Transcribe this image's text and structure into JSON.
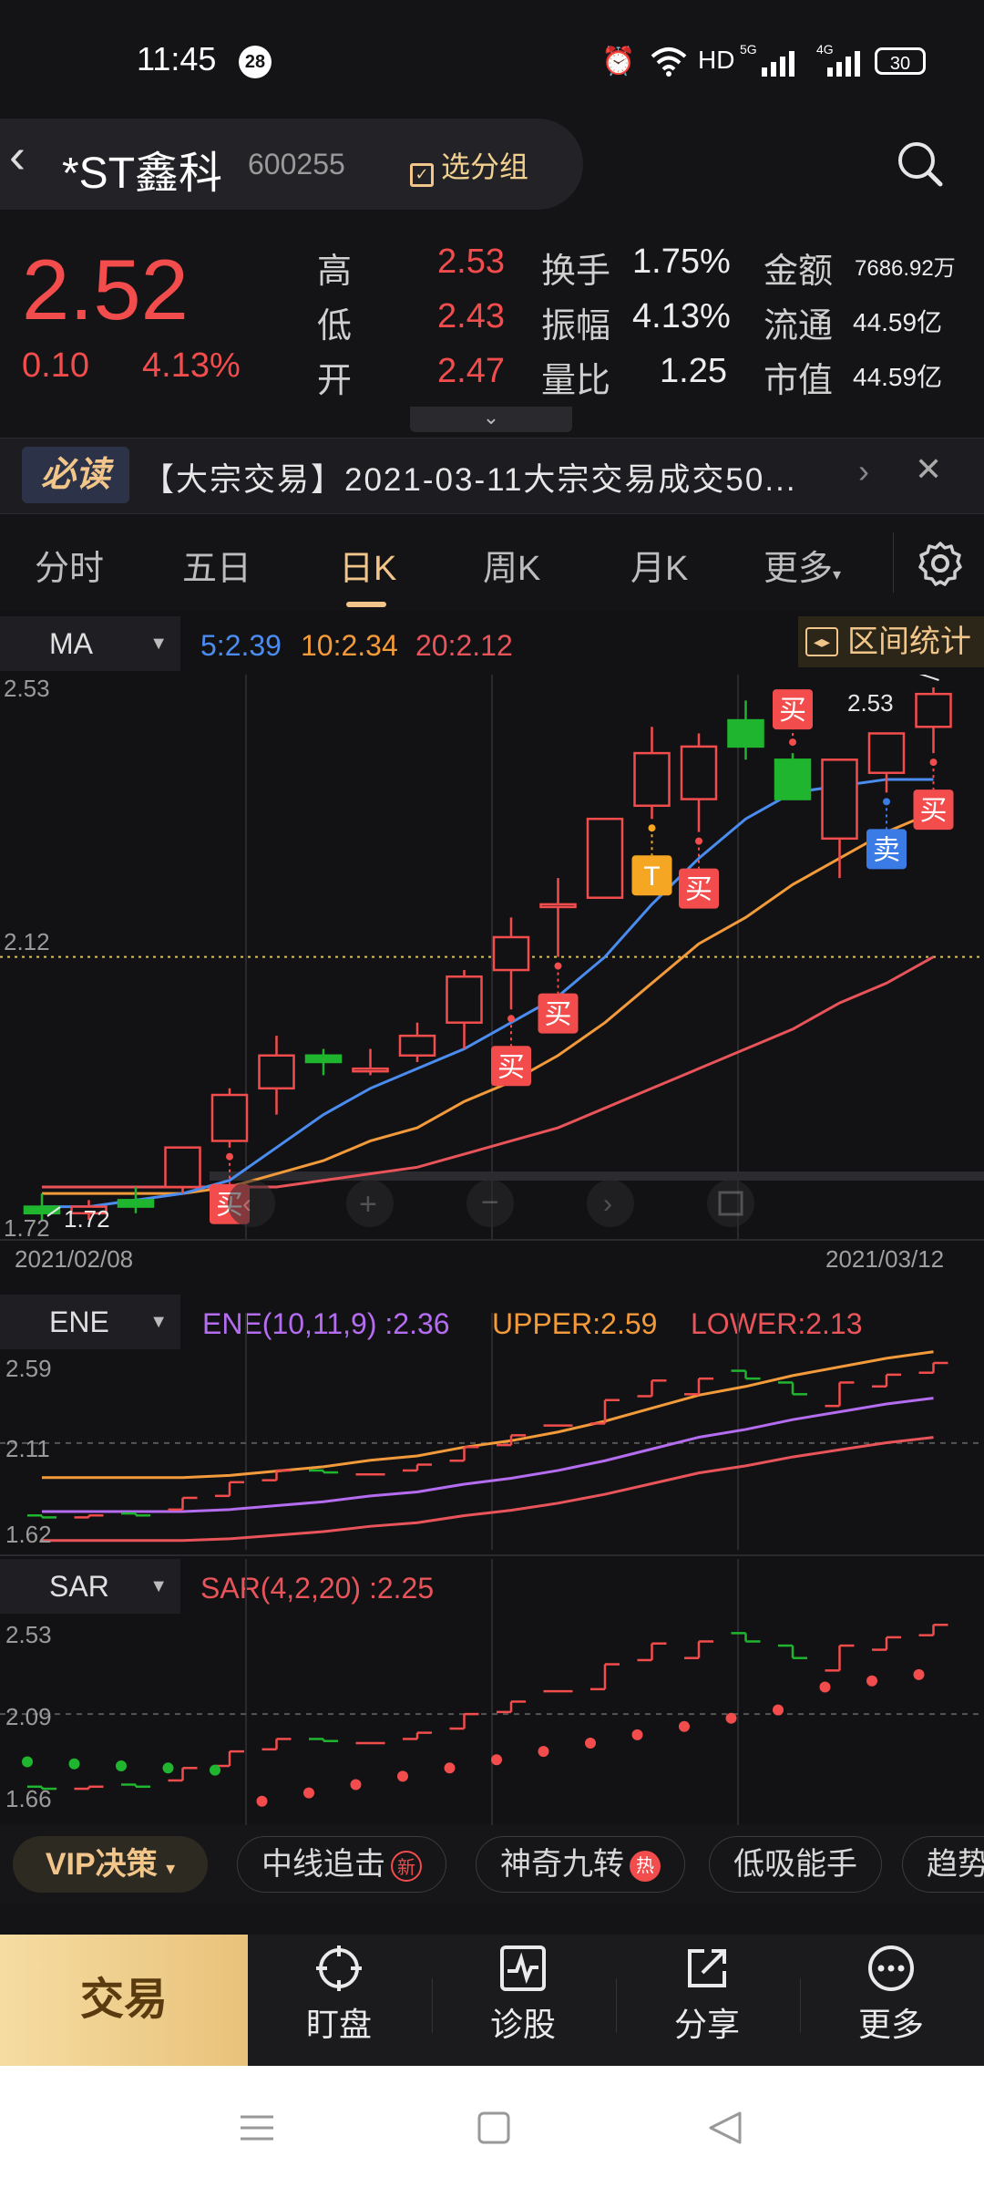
{
  "status": {
    "time": "11:45",
    "notif_count": "28",
    "hd": "HD",
    "net1": "5G",
    "net2": "4G",
    "battery": "30"
  },
  "header": {
    "name": "*ST鑫科",
    "code": "600255",
    "group_label": "选分组"
  },
  "quote": {
    "price": "2.52",
    "change": "0.10",
    "change_pct": "4.13%",
    "high_label": "高",
    "high": "2.53",
    "low_label": "低",
    "low": "2.43",
    "open_label": "开",
    "open": "2.47",
    "turnover_label": "换手",
    "turnover": "1.75%",
    "amplitude_label": "振幅",
    "amplitude": "4.13%",
    "volratio_label": "量比",
    "volratio": "1.25",
    "amount_label": "金额",
    "amount": "7686.92万",
    "float_label": "流通",
    "float": "44.59亿",
    "mcap_label": "市值",
    "mcap": "44.59亿"
  },
  "news": {
    "tag": "必读",
    "text": "【大宗交易】2021-03-11大宗交易成交50..."
  },
  "tabs": [
    "分时",
    "五日",
    "日K",
    "周K",
    "月K",
    "更多"
  ],
  "main_chart": {
    "indicator": "MA",
    "ma5": "5:2.39",
    "ma10": "10:2.34",
    "ma20": "20:2.12",
    "range_label": "区间统计",
    "top_label": "2.53",
    "mid_label": "2.12",
    "bottom_label": "1.72",
    "high_callout": "2.53",
    "low_callout": "1.72",
    "start_date": "2021/02/08",
    "end_date": "2021/03/12",
    "buy_label": "买",
    "sell_label": "卖",
    "t_label": "T"
  },
  "ene_panel": {
    "indicator": "ENE",
    "ene": "ENE(10,11,9) :2.36",
    "upper": "UPPER:2.59",
    "lower": "LOWER:2.13",
    "top_label": "2.59",
    "mid_label": "2.11",
    "bottom_label": "1.62"
  },
  "sar_panel": {
    "indicator": "SAR",
    "sar": "SAR(4,2,20) :2.25",
    "top_label": "2.53",
    "mid_label": "2.09",
    "bottom_label": "1.66"
  },
  "vip_strip": {
    "vip": "VIP决策",
    "items": [
      {
        "label": "中线追击",
        "badge": "新"
      },
      {
        "label": "神奇九转",
        "badge": "热"
      },
      {
        "label": "低吸能手",
        "badge": ""
      },
      {
        "label": "趋势",
        "badge": ""
      }
    ]
  },
  "bottom_nav": {
    "trade": "交易",
    "items": [
      "盯盘",
      "诊股",
      "分享",
      "更多"
    ]
  },
  "colors": {
    "up": "#f24c4c",
    "down": "#1fb52f",
    "ma5": "#4a8cf0",
    "ma10": "#f39a3a",
    "ma20": "#e8545a",
    "ene": "#b46cf0",
    "accent": "#f2c58a"
  },
  "chart_data": {
    "type": "candlestick",
    "period": "daily",
    "dates": [
      "2021/02/08",
      "2021/03/12"
    ],
    "candles": [
      {
        "o": 1.74,
        "c": 1.73,
        "h": 1.76,
        "l": 1.72
      },
      {
        "o": 1.73,
        "c": 1.74,
        "h": 1.75,
        "l": 1.72
      },
      {
        "o": 1.75,
        "c": 1.74,
        "h": 1.77,
        "l": 1.73
      },
      {
        "o": 1.77,
        "c": 1.83,
        "h": 1.83,
        "l": 1.76
      },
      {
        "o": 1.84,
        "c": 1.91,
        "h": 1.92,
        "l": 1.83
      },
      {
        "o": 1.92,
        "c": 1.97,
        "h": 2.0,
        "l": 1.88
      },
      {
        "o": 1.97,
        "c": 1.96,
        "h": 1.98,
        "l": 1.94
      },
      {
        "o": 1.95,
        "c": 1.95,
        "h": 1.98,
        "l": 1.94
      },
      {
        "o": 1.97,
        "c": 2.0,
        "h": 2.02,
        "l": 1.96
      },
      {
        "o": 2.02,
        "c": 2.09,
        "h": 2.1,
        "l": 1.98
      },
      {
        "o": 2.1,
        "c": 2.15,
        "h": 2.18,
        "l": 2.04
      },
      {
        "o": 2.2,
        "c": 2.2,
        "h": 2.24,
        "l": 2.12
      },
      {
        "o": 2.21,
        "c": 2.33,
        "h": 2.33,
        "l": 2.21
      },
      {
        "o": 2.35,
        "c": 2.43,
        "h": 2.47,
        "l": 2.33
      },
      {
        "o": 2.36,
        "c": 2.44,
        "h": 2.46,
        "l": 2.31
      },
      {
        "o": 2.48,
        "c": 2.44,
        "h": 2.51,
        "l": 2.42
      },
      {
        "o": 2.42,
        "c": 2.36,
        "h": 2.43,
        "l": 2.36
      },
      {
        "o": 2.3,
        "c": 2.42,
        "h": 2.42,
        "l": 2.24
      },
      {
        "o": 2.4,
        "c": 2.46,
        "h": 2.46,
        "l": 2.37
      },
      {
        "o": 2.47,
        "c": 2.52,
        "h": 2.53,
        "l": 2.43
      }
    ],
    "ma5": [
      1.74,
      1.74,
      1.75,
      1.76,
      1.78,
      1.83,
      1.88,
      1.92,
      1.95,
      1.98,
      2.02,
      2.06,
      2.12,
      2.2,
      2.27,
      2.33,
      2.37,
      2.38,
      2.39,
      2.39
    ],
    "ma10": [
      1.76,
      1.76,
      1.76,
      1.76,
      1.77,
      1.79,
      1.81,
      1.84,
      1.86,
      1.9,
      1.93,
      1.97,
      2.02,
      2.08,
      2.14,
      2.18,
      2.23,
      2.27,
      2.31,
      2.34
    ],
    "ma20": [
      1.77,
      1.77,
      1.77,
      1.77,
      1.77,
      1.77,
      1.78,
      1.79,
      1.8,
      1.82,
      1.84,
      1.86,
      1.89,
      1.92,
      1.95,
      1.98,
      2.01,
      2.05,
      2.08,
      2.12
    ],
    "signals": [
      {
        "i": 4,
        "type": "买"
      },
      {
        "i": 10,
        "type": "买"
      },
      {
        "i": 11,
        "type": "买"
      },
      {
        "i": 13,
        "type": "T"
      },
      {
        "i": 14,
        "type": "买"
      },
      {
        "i": 16,
        "type": "买"
      },
      {
        "i": 18,
        "type": "卖"
      },
      {
        "i": 19,
        "type": "买"
      }
    ],
    "ylim": [
      1.72,
      2.53
    ]
  }
}
